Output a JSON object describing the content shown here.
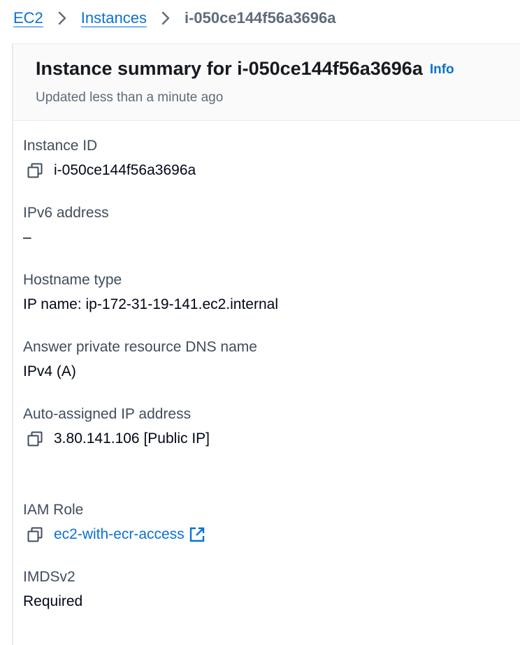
{
  "breadcrumb": {
    "root": "EC2",
    "instances": "Instances",
    "current": "i-050ce144f56a3696a"
  },
  "summary": {
    "title": "Instance summary for i-050ce144f56a3696a",
    "info_label": "Info",
    "updated": "Updated less than a minute ago"
  },
  "fields": {
    "instance_id": {
      "label": "Instance ID",
      "value": "i-050ce144f56a3696a"
    },
    "ipv6": {
      "label": "IPv6 address",
      "value": "–"
    },
    "hostname_type": {
      "label": "Hostname type",
      "value": "IP name: ip-172-31-19-141.ec2.internal"
    },
    "answer_dns": {
      "label": "Answer private resource DNS name",
      "value": "IPv4 (A)"
    },
    "auto_ip": {
      "label": "Auto-assigned IP address",
      "value": "3.80.141.106 [Public IP]"
    },
    "iam_role": {
      "label": "IAM Role",
      "value": "ec2-with-ecr-access"
    },
    "imdsv2": {
      "label": "IMDSv2",
      "value": "Required"
    }
  },
  "colors": {
    "link": "#0972d3",
    "label": "#414d5c",
    "muted": "#5f6b7a",
    "header_bg": "#fafafa"
  },
  "icons": {
    "copy": "copy-icon",
    "external": "external-link-icon",
    "separator": "chevron-right-icon"
  }
}
